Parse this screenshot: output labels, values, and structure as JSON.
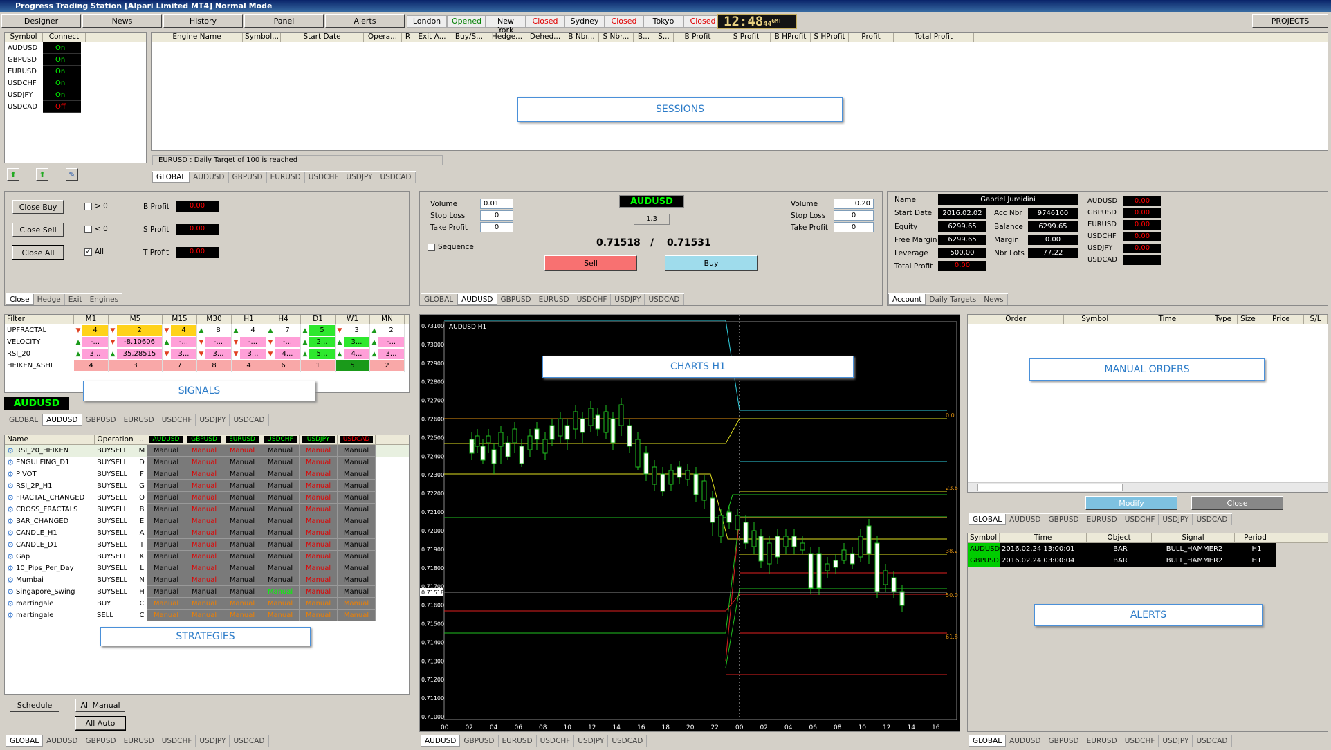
{
  "window": {
    "title": "Progress Trading Station [Alpari Limited MT4] Normal Mode"
  },
  "toolbar": {
    "designer": "Designer",
    "news": "News",
    "history": "History",
    "panel": "Panel",
    "alerts": "Alerts",
    "projects": "PROJECTS",
    "markets": [
      {
        "name": "London",
        "status": "Opened",
        "color": "#008000"
      },
      {
        "name": "New York",
        "status": "Closed",
        "color": "#e00000"
      },
      {
        "name": "Sydney",
        "status": "Closed",
        "color": "#e00000"
      },
      {
        "name": "Tokyo",
        "status": "Closed",
        "color": "#e00000"
      }
    ],
    "clock": "12:48",
    "clock_sec": "44",
    "clock_tz": "GMT"
  },
  "connect": {
    "headers": [
      "Symbol",
      "Connect"
    ],
    "rows": [
      [
        "AUDUSD",
        "On"
      ],
      [
        "GBPUSD",
        "On"
      ],
      [
        "EURUSD",
        "On"
      ],
      [
        "USDCHF",
        "On"
      ],
      [
        "USDJPY",
        "On"
      ],
      [
        "USDCAD",
        "Off"
      ]
    ]
  },
  "sessions": {
    "label": "SESSIONS",
    "columns": [
      "Engine Name",
      "Symbol...",
      "Start Date",
      "Opera...",
      "R",
      "Exit A...",
      "Buy/S...",
      "Hedge...",
      "Dehed...",
      "B Nbr...",
      "S Nbr...",
      "B...",
      "S...",
      "B Profit",
      "S Profit",
      "B HProfit",
      "S HProfit",
      "Profit",
      "Total Profit"
    ],
    "status": "EURUSD : Daily Target of 100 is reached",
    "tabs": [
      "GLOBAL",
      "AUDUSD",
      "GBPUSD",
      "EURUSD",
      "USDCHF",
      "USDJPY",
      "USDCAD"
    ]
  },
  "close_panel": {
    "close_buy": "Close Buy",
    "close_sell": "Close Sell",
    "close_all": "Close All",
    "gt": "> 0",
    "lt": "< 0",
    "all": "All",
    "b_profit": "B Profit",
    "s_profit": "S Profit",
    "t_profit": "T Profit",
    "b_val": "0.00",
    "s_val": "0.00",
    "t_val": "0.00",
    "tabs": [
      "Close",
      "Hedge",
      "Exit",
      "Engines"
    ]
  },
  "order_panel": {
    "symbol": "AUDUSD",
    "volume_lbl": "Volume",
    "sl_lbl": "Stop Loss",
    "tp_lbl": "Take Profit",
    "sell_volume": "0.01",
    "sell_sl": "0",
    "sell_tp": "0",
    "buy_volume": "0.20",
    "buy_sl": "0",
    "buy_tp": "0",
    "spread": "1.3",
    "bid": "0.71518",
    "sep": "/",
    "ask": "0.71531",
    "sequence": "Sequence",
    "sell": "Sell",
    "buy": "Buy",
    "tabs": [
      "GLOBAL",
      "AUDUSD",
      "GBPUSD",
      "EURUSD",
      "USDCHF",
      "USDJPY",
      "USDCAD"
    ]
  },
  "account": {
    "name_lbl": "Name",
    "name": "Gabriel Jureidini",
    "start_lbl": "Start Date",
    "start": "2016.02.02",
    "accnbr_lbl": "Acc Nbr",
    "accnbr": "9746100",
    "equity_lbl": "Equity",
    "equity": "6299.65",
    "balance_lbl": "Balance",
    "balance": "6299.65",
    "freemargin_lbl": "Free Margin",
    "freemargin": "6299.65",
    "margin_lbl": "Margin",
    "margin": "0.00",
    "leverage_lbl": "Leverage",
    "leverage": "500.00",
    "nbrlots_lbl": "Nbr Lots",
    "nbrlots": "77.22",
    "totalprofit_lbl": "Total Profit",
    "totalprofit": "0.00",
    "symbols": [
      [
        "AUDUSD",
        "0.00"
      ],
      [
        "GBPUSD",
        "0.00"
      ],
      [
        "EURUSD",
        "0.00"
      ],
      [
        "USDCHF",
        "0.00"
      ],
      [
        "USDJPY",
        "0.00"
      ],
      [
        "USDCAD",
        ""
      ]
    ],
    "tabs": [
      "Account",
      "Daily Targets",
      "News"
    ]
  },
  "signals": {
    "label": "SIGNALS",
    "filter": "Filter",
    "timeframes": [
      "M1",
      "M5",
      "M15",
      "M30",
      "H1",
      "H4",
      "D1",
      "W1",
      "MN"
    ],
    "rows": [
      {
        "name": "UPFRACTAL",
        "cells": [
          "4",
          "2",
          "4",
          "8",
          "4",
          "7",
          "5",
          "3",
          "2"
        ]
      },
      {
        "name": "VELOCITY",
        "cells": [
          "-...",
          "-8.10606",
          "-...",
          "-...",
          "-...",
          "-...",
          "2...",
          "3...",
          "-..."
        ]
      },
      {
        "name": "RSI_20",
        "cells": [
          "3...",
          "35.28515",
          "3...",
          "3...",
          "3...",
          "4...",
          "5...",
          "4...",
          "3..."
        ]
      },
      {
        "name": "HEIKEN_ASHI",
        "cells": [
          "4",
          "3",
          "7",
          "8",
          "4",
          "6",
          "1",
          "5",
          "2"
        ]
      }
    ],
    "symbol": "AUDUSD",
    "tabs": [
      "GLOBAL",
      "AUDUSD",
      "GBPUSD",
      "EURUSD",
      "USDCHF",
      "USDJPY",
      "USDCAD"
    ]
  },
  "strategies": {
    "label": "STRATEGIES",
    "name_hdr": "Name",
    "op_hdr": "Operation",
    "col_hdr": "..",
    "syms": [
      "AUDUSD",
      "GBPUSD",
      "EURUSD",
      "USDCHF",
      "USDJPY",
      "USDCAD"
    ],
    "rows": [
      [
        "RSI_20_HEIKEN",
        "BUYSELL",
        "M"
      ],
      [
        "ENGULFING_D1",
        "BUYSELL",
        "D"
      ],
      [
        "PIVOT",
        "BUYSELL",
        "F"
      ],
      [
        "RSI_2P_H1",
        "BUYSELL",
        "G"
      ],
      [
        "FRACTAL_CHANGED",
        "BUYSELL",
        "O"
      ],
      [
        "CROSS_FRACTALS",
        "BUYSELL",
        "B"
      ],
      [
        "BAR_CHANGED",
        "BUYSELL",
        "E"
      ],
      [
        "CANDLE_H1",
        "BUYSELL",
        "A"
      ],
      [
        "CANDLE_D1",
        "BUYSELL",
        "I"
      ],
      [
        "Gap",
        "BUYSELL",
        "K"
      ],
      [
        "10_Pips_Per_Day",
        "BUYSELL",
        "L"
      ],
      [
        "Mumbai",
        "BUYSELL",
        "N"
      ],
      [
        "Singapore_Swing",
        "BUYSELL",
        "H"
      ],
      [
        "martingale",
        "BUY",
        "C"
      ],
      [
        "martingale",
        "SELL",
        "C"
      ]
    ],
    "manual": "Manual",
    "schedule": "Schedule",
    "all_manual": "All Manual",
    "all_auto": "All Auto",
    "tabs": [
      "GLOBAL",
      "AUDUSD",
      "GBPUSD",
      "EURUSD",
      "USDCHF",
      "USDJPY",
      "USDCAD"
    ]
  },
  "chart": {
    "label": "CHARTS H1",
    "title": "AUDUSD H1",
    "price_tag": "0.71518",
    "yticks": [
      "0.73100",
      "0.73000",
      "0.72900",
      "0.72800",
      "0.72700",
      "0.72600",
      "0.72500",
      "0.72400",
      "0.72300",
      "0.72200",
      "0.72100",
      "0.72000",
      "0.71900",
      "0.71800",
      "0.71700",
      "0.71600",
      "0.71500",
      "0.71400",
      "0.71300",
      "0.71200",
      "0.71100",
      "0.71000"
    ],
    "xticks": [
      "00",
      "02",
      "04",
      "06",
      "08",
      "10",
      "12",
      "14",
      "16",
      "18",
      "20",
      "22",
      "00",
      "02",
      "04",
      "06",
      "08",
      "10",
      "12",
      "14",
      "16"
    ],
    "fib": [
      "0.0",
      "23.6",
      "38.2",
      "50.0",
      "61.8"
    ],
    "tabs": [
      "AUDUSD",
      "GBPUSD",
      "EURUSD",
      "USDCHF",
      "USDJPY",
      "USDCAD"
    ]
  },
  "manual_orders": {
    "label": "MANUAL ORDERS",
    "columns": [
      "Order",
      "Symbol",
      "Time",
      "Type",
      "Size",
      "Price",
      "S/L"
    ],
    "modify": "Modify",
    "close": "Close",
    "tabs": [
      "GLOBAL",
      "AUDUSD",
      "GBPUSD",
      "EURUSD",
      "USDCHF",
      "USDJPY",
      "USDCAD"
    ]
  },
  "alerts": {
    "label": "ALERTS",
    "columns": [
      "Symbol",
      "Time",
      "Object",
      "Signal",
      "Period"
    ],
    "rows": [
      [
        "AUDUSD",
        "2016.02.24 13:00:01",
        "BAR",
        "BULL_HAMMER2",
        "H1"
      ],
      [
        "GBPUSD",
        "2016.02.24 03:00:04",
        "BAR",
        "BULL_HAMMER2",
        "H1"
      ]
    ],
    "tabs": [
      "GLOBAL",
      "AUDUSD",
      "GBPUSD",
      "EURUSD",
      "USDCHF",
      "USDJPY",
      "USDCAD"
    ]
  }
}
